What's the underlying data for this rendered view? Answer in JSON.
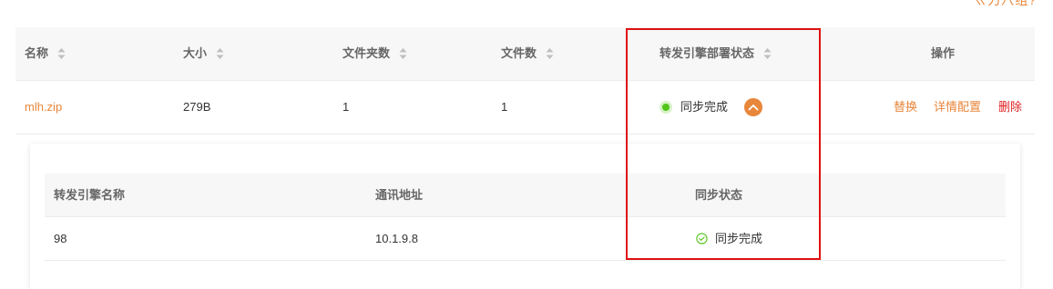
{
  "corner_fragment": "ㄍ力八组?",
  "table": {
    "columns": [
      {
        "label": "名称",
        "sortable": true
      },
      {
        "label": "大小",
        "sortable": true
      },
      {
        "label": "文件夹数",
        "sortable": true
      },
      {
        "label": "文件数",
        "sortable": true
      },
      {
        "label": "转发引擎部署状态",
        "sortable": true
      },
      {
        "label": "操作",
        "sortable": false
      }
    ],
    "rows": [
      {
        "name": "mlh.zip",
        "size": "279B",
        "folder_count": "1",
        "file_count": "1",
        "status": "同步完成",
        "actions": {
          "replace": "替换",
          "detail_config": "详情配置",
          "delete": "删除"
        }
      }
    ]
  },
  "sub_table": {
    "columns": [
      "转发引擎名称",
      "通讯地址",
      "同步状态"
    ],
    "rows": [
      {
        "engine_name": "98",
        "address": "10.1.9.8",
        "sync_status": "同步完成"
      }
    ]
  },
  "colors": {
    "accent": "#e8863a",
    "danger": "#e02020",
    "success": "#52c41a",
    "highlight": "#e01010"
  }
}
